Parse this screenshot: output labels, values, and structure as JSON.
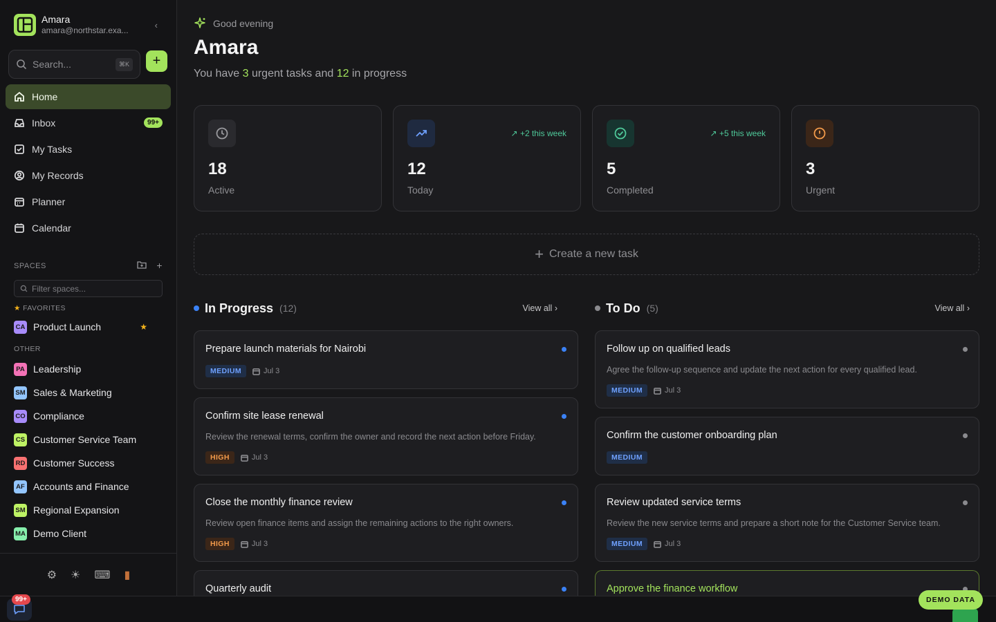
{
  "profile": {
    "name": "Amara",
    "email": "amara@northstar.exa..."
  },
  "search": {
    "placeholder": "Search...",
    "shortcut": "⌘K"
  },
  "nav": [
    {
      "label": "Home",
      "icon": "home-icon",
      "active": true
    },
    {
      "label": "Inbox",
      "icon": "inbox-icon",
      "badge": "99+"
    },
    {
      "label": "My Tasks",
      "icon": "check-square-icon"
    },
    {
      "label": "My Records",
      "icon": "user-circle-icon"
    },
    {
      "label": "Planner",
      "icon": "planner-icon"
    },
    {
      "label": "Calendar",
      "icon": "calendar-icon"
    }
  ],
  "spaces": {
    "header": "SPACES",
    "filter_placeholder": "Filter spaces...",
    "favorites_label": "FAVORITES",
    "other_label": "OTHER",
    "favorites": [
      {
        "tag": "CA",
        "name": "Product Launch",
        "color": "#a78bfa"
      }
    ],
    "other": [
      {
        "tag": "PA",
        "name": "Leadership",
        "color": "#f472b6"
      },
      {
        "tag": "SM",
        "name": "Sales & Marketing",
        "color": "#93c5fd"
      },
      {
        "tag": "CO",
        "name": "Compliance",
        "color": "#a78bfa"
      },
      {
        "tag": "CS",
        "name": "Customer Service Team",
        "color": "#bef264"
      },
      {
        "tag": "RD",
        "name": "Customer Success",
        "color": "#f87171"
      },
      {
        "tag": "AF",
        "name": "Accounts and Finance",
        "color": "#93c5fd"
      },
      {
        "tag": "SM",
        "name": "Regional Expansion",
        "color": "#bef264"
      },
      {
        "tag": "MA",
        "name": "Demo Client",
        "color": "#86efac"
      }
    ]
  },
  "bottom": {
    "chat_badge": "99+",
    "demo_label": "DEMO DATA"
  },
  "header": {
    "greeting": "Good evening",
    "title": "Amara",
    "subtitle_pre": "You have ",
    "urgent_count": "3",
    "subtitle_mid": " urgent tasks and ",
    "progress_count": "12",
    "subtitle_post": " in progress"
  },
  "stats": [
    {
      "value": "18",
      "label": "Active",
      "icon": "clock-icon",
      "trend": ""
    },
    {
      "value": "12",
      "label": "Today",
      "icon": "trending-up-icon",
      "trend": "+2 this week"
    },
    {
      "value": "5",
      "label": "Completed",
      "icon": "check-circle-icon",
      "trend": "+5 this week"
    },
    {
      "value": "3",
      "label": "Urgent",
      "icon": "alert-circle-icon",
      "trend": ""
    }
  ],
  "create_task_label": "Create a new task",
  "in_progress": {
    "title": "In Progress",
    "count": "(12)",
    "view_all": "View all",
    "tasks": [
      {
        "title": "Prepare launch materials for Nairobi",
        "desc": "",
        "priority": "MEDIUM",
        "date": "Jul 3"
      },
      {
        "title": "Confirm site lease renewal",
        "desc": "Review the renewal terms, confirm the owner and record the next action before Friday.",
        "priority": "HIGH",
        "date": "Jul 3"
      },
      {
        "title": "Close the monthly finance review",
        "desc": "Review open finance items and assign the remaining actions to the right owners.",
        "priority": "HIGH",
        "date": "Jul 3"
      },
      {
        "title": "Quarterly audit",
        "desc": "",
        "priority": "",
        "date": ""
      }
    ]
  },
  "todo": {
    "title": "To Do",
    "count": "(5)",
    "view_all": "View all",
    "tasks": [
      {
        "title": "Follow up on qualified leads",
        "desc": "Agree the follow-up sequence and update the next action for every qualified lead.",
        "priority": "MEDIUM",
        "date": "Jul 3"
      },
      {
        "title": "Confirm the customer onboarding plan",
        "desc": "",
        "priority": "MEDIUM",
        "date": ""
      },
      {
        "title": "Review updated service terms",
        "desc": "Review the new service terms and prepare a short note for the Customer Service team.",
        "priority": "MEDIUM",
        "date": "Jul 3"
      },
      {
        "title": "Approve the finance workflow",
        "desc": "",
        "priority": "",
        "date": ""
      }
    ]
  },
  "colors": {
    "accent": "#a3e35c",
    "in_progress_dot": "#3b82f6",
    "todo_dot": "#8a8a8e",
    "trend": "#4fc99a"
  }
}
